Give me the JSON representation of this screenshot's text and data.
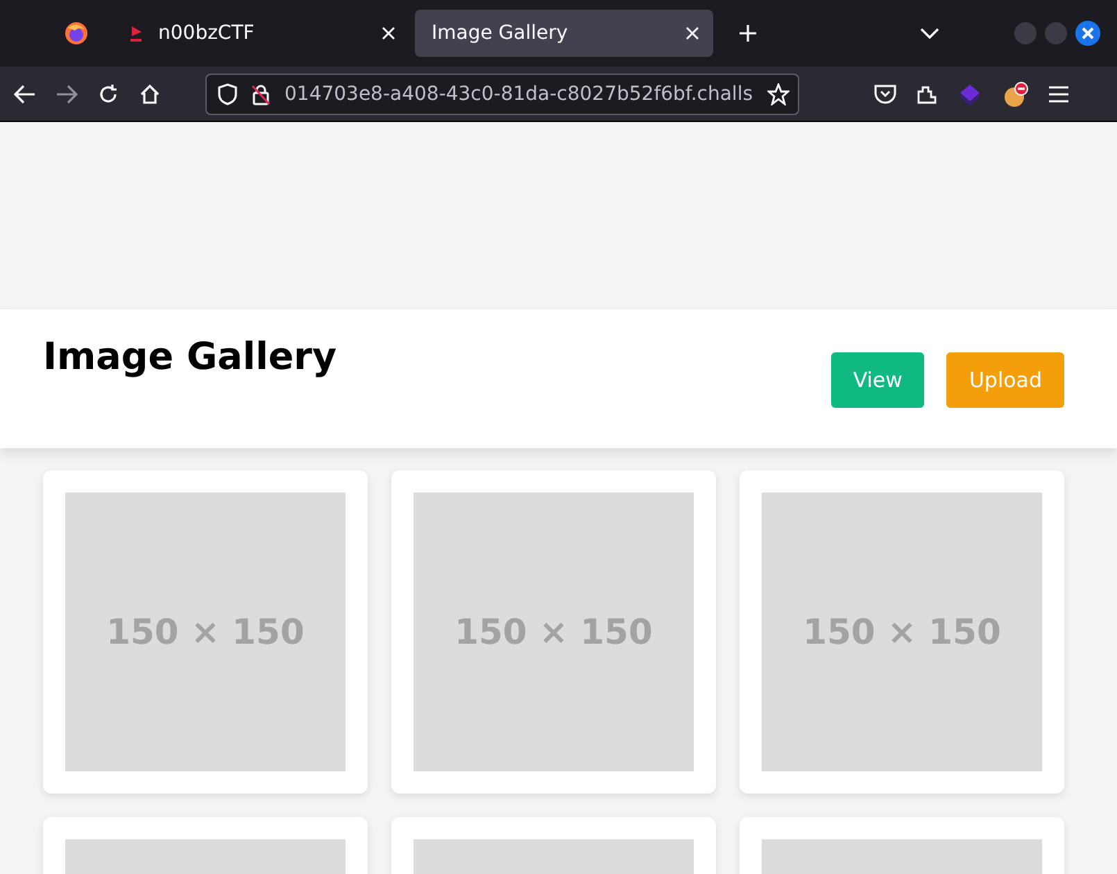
{
  "browser": {
    "tabs": [
      {
        "title": "n00bzCTF",
        "selected": false
      },
      {
        "title": "Image Gallery",
        "selected": true
      }
    ],
    "address": "014703e8-a408-43c0-81da-c8027b52f6bf.challs"
  },
  "header": {
    "title": "Image Gallery",
    "buttons": [
      {
        "label": "View",
        "color": "#10b981"
      },
      {
        "label": "Upload",
        "color": "#f59e0b"
      }
    ]
  },
  "cards": [
    {
      "kind": "placeholder",
      "image_text": "150 × 150"
    },
    {
      "kind": "placeholder",
      "image_text": "150 × 150"
    },
    {
      "kind": "placeholder",
      "image_text": "150 × 150"
    },
    {
      "kind": "placeholder"
    },
    {
      "kind": "placeholder"
    },
    {
      "kind": "placeholder"
    }
  ]
}
